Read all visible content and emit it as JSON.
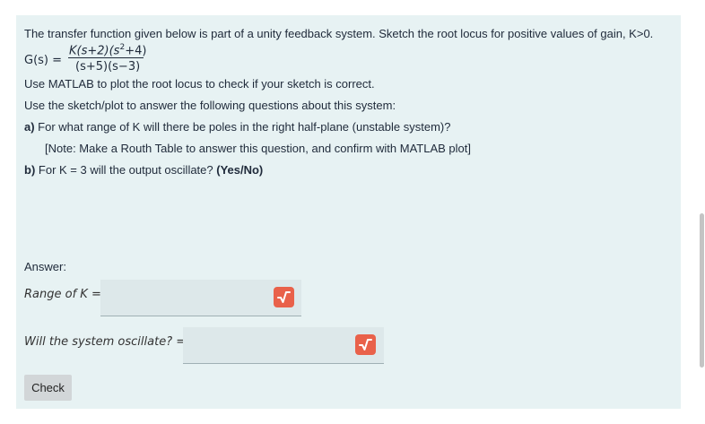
{
  "question": {
    "intro": "The transfer function given below is part of a unity feedback system.  Sketch the root locus for positive values of gain, K>0.",
    "transfer_function": {
      "lhs": "G(s)  =",
      "numerator_a": "K(s+2)(s",
      "numerator_exp": "2",
      "numerator_b": "+4)",
      "denominator": "(s+5)(s−3)"
    },
    "matlab_line": "Use MATLAB to plot the root locus to check if your sketch is correct.",
    "instructions": "Use the sketch/plot to answer the following questions about this system:",
    "part_a": {
      "prefix": "a)",
      "text": " For what range of K will there be poles in the right half-plane (unstable system)?",
      "note": "[Note: Make a Routh Table to answer this question, and confirm with MATLAB plot]"
    },
    "part_b": {
      "prefix": "b)",
      "text": " For K = 3 will the output oscillate? ",
      "suffix": "(Yes/No)"
    }
  },
  "answer": {
    "heading": "Answer:",
    "range_label": "Range of K  =",
    "range_value": "",
    "oscillate_label": "Will the system oscillate?  =",
    "oscillate_value": ""
  },
  "buttons": {
    "check_label": "Check"
  },
  "icons": {
    "answer_field_icon": "square-root-icon"
  },
  "colors": {
    "panel_bg": "#e7f2f3",
    "badge": "#e9614a",
    "button_bg": "#d2d6d8"
  }
}
